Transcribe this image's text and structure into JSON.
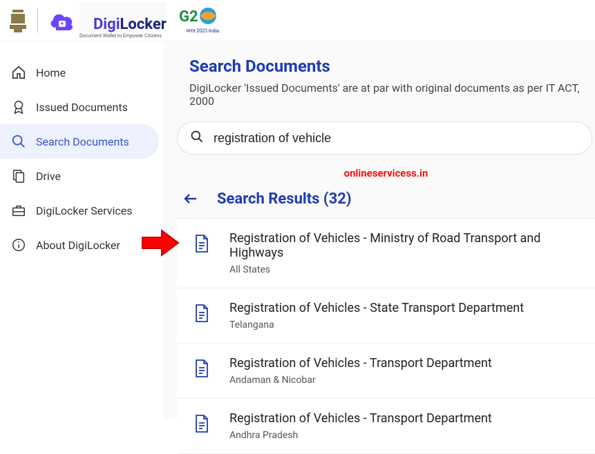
{
  "header": {
    "brand_primary": "Digi",
    "brand_secondary": "Locker",
    "tagline": "Document Wallet to Empower Citizens",
    "g20_label": "G2",
    "g20_sub": "भारत 2023 India"
  },
  "sidebar": {
    "items": [
      {
        "label": "Home"
      },
      {
        "label": "Issued Documents"
      },
      {
        "label": "Search Documents"
      },
      {
        "label": "Drive"
      },
      {
        "label": "DigiLocker Services"
      },
      {
        "label": "About DigiLocker"
      }
    ]
  },
  "page": {
    "title": "Search Documents",
    "subtitle": "DigiLocker 'Issued Documents' are at par with original documents as per IT ACT, 2000",
    "search_value": "registration of vehicle",
    "watermark": "onlineservicess.in",
    "results_heading": "Search Results (32)"
  },
  "results": [
    {
      "title": "Registration of Vehicles - Ministry of Road Transport and Highways",
      "sub": "All States"
    },
    {
      "title": "Registration of Vehicles - State Transport Department",
      "sub": "Telangana"
    },
    {
      "title": "Registration of Vehicles - Transport Department",
      "sub": "Andaman & Nicobar"
    },
    {
      "title": "Registration of Vehicles - Transport Department",
      "sub": "Andhra Pradesh"
    }
  ],
  "colors": {
    "accent": "#1f3bb3",
    "sidebar_active_bg": "#edf1fe"
  }
}
